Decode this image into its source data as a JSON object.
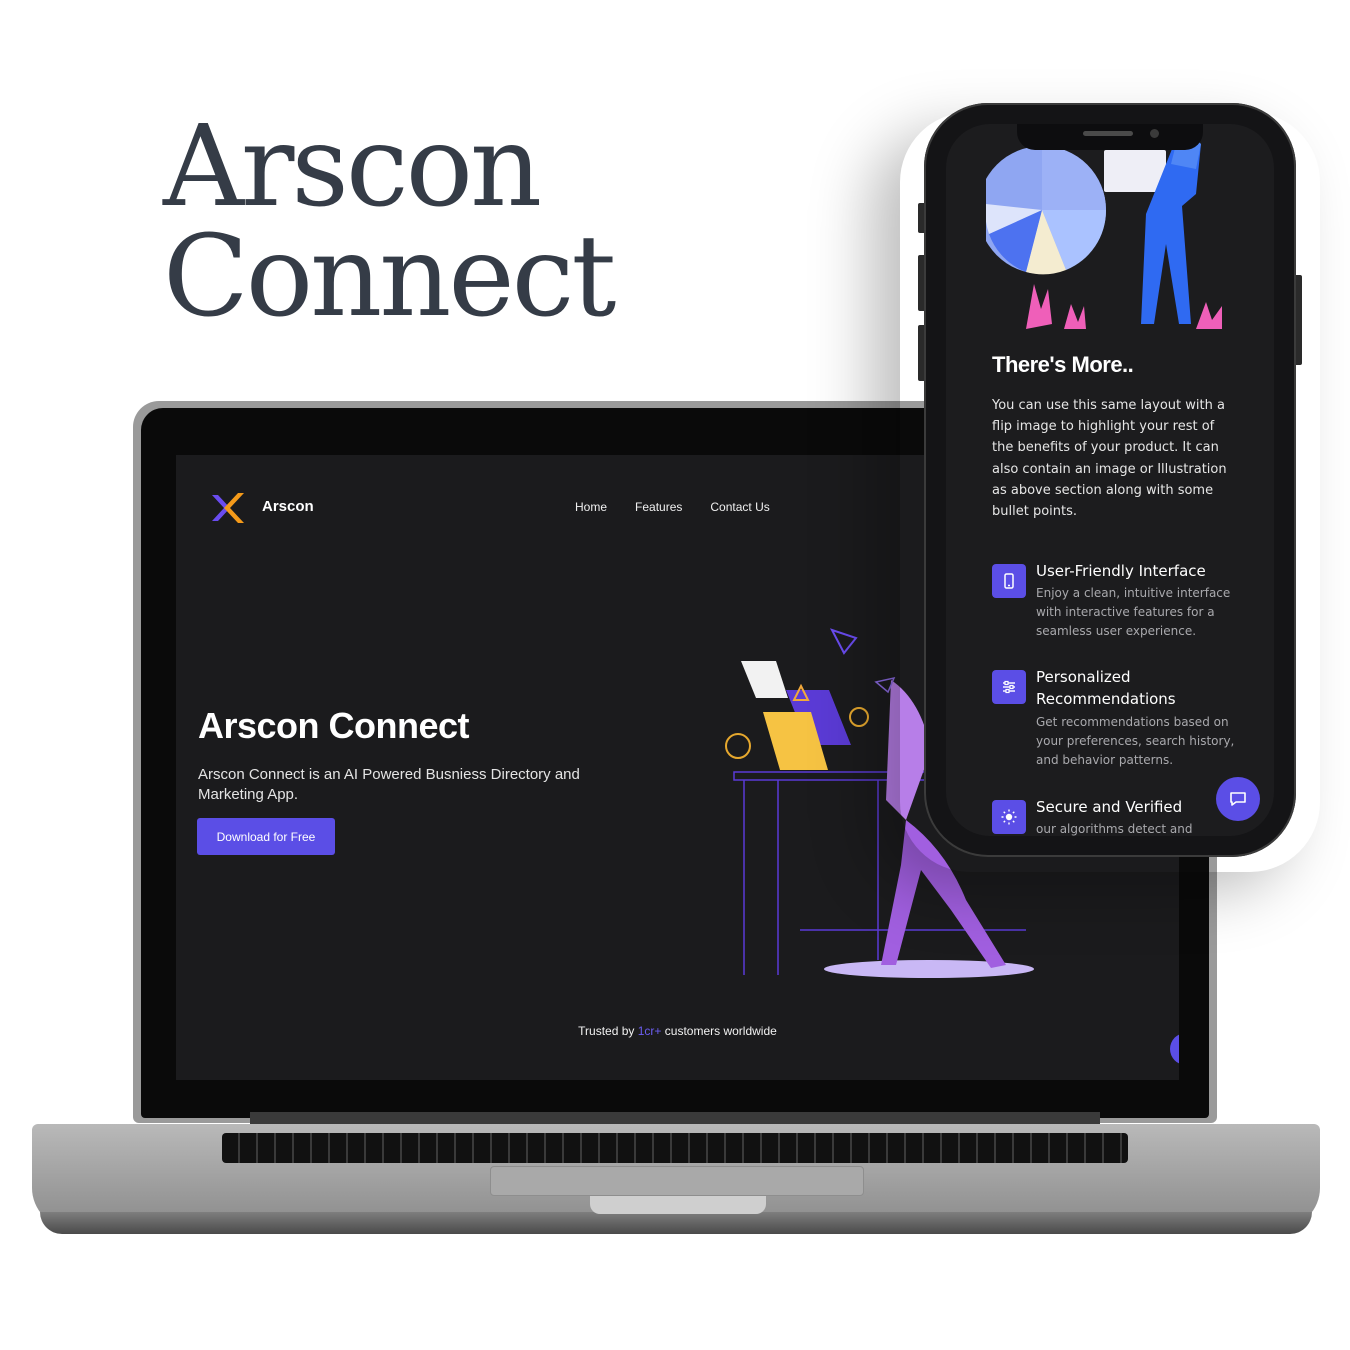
{
  "headline": {
    "line1": "Arscon",
    "line2": "Connect"
  },
  "laptop_site": {
    "brand": "Arscon",
    "nav": [
      "Home",
      "Features",
      "Contact Us"
    ],
    "hero_title": "Arscon Connect",
    "hero_description": "Arscon Connect is an AI Powered Busniess Directory and Marketing App.",
    "cta_label": "Download for Free",
    "trust": {
      "prefix": "Trusted by ",
      "highlight": "1cr+",
      "suffix": " customers worldwide"
    }
  },
  "phone_site": {
    "section_title": "There's More..",
    "section_description": "You can use this same layout with a flip image to highlight your rest of the benefits of your product. It can also contain an image or Illustration as above section along with some bullet points.",
    "features": [
      {
        "icon": "smartphone-icon",
        "title": "User-Friendly Interface",
        "description": "Enjoy a clean, intuitive interface with interactive features for a seamless user experience."
      },
      {
        "icon": "sliders-icon",
        "title": "Personalized Recommendations",
        "description": "Get recommendations based on your preferences, search history, and behavior patterns."
      },
      {
        "icon": "sun-icon",
        "title": "Secure and Verified",
        "description": "our algorithms detect and"
      }
    ]
  },
  "colors": {
    "accent": "#5b4ee6",
    "headline": "#353c47",
    "screen_bg": "#1b1b1d",
    "highlight": "#6c5ef2"
  }
}
